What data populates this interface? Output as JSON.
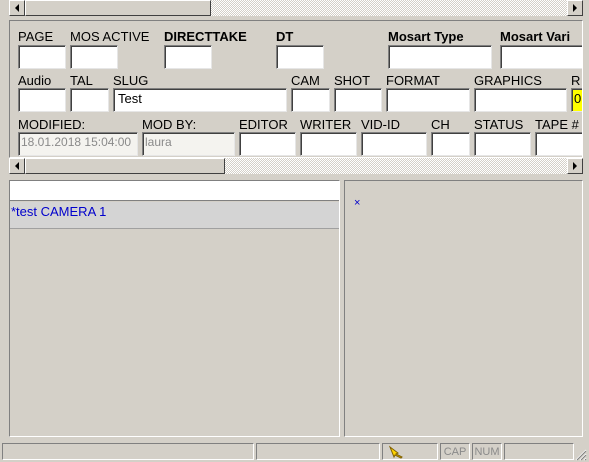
{
  "header_fields": {
    "row1": {
      "page": "PAGE",
      "mos_active": "MOS ACTIVE",
      "directtake": "DIRECTTAKE",
      "dt": "DT",
      "mosart_type": "Mosart Type",
      "mosart_variant": "Mosart Vari"
    },
    "row2": {
      "audio": "Audio",
      "tal": "TAL",
      "slug": "SLUG",
      "slug_value": "Test",
      "cam": "CAM",
      "shot": "SHOT",
      "format": "FORMAT",
      "graphics": "GRAPHICS",
      "r": "R",
      "r_value": "0"
    },
    "row3": {
      "modified": "MODIFIED:",
      "modified_value": "18.01.2018 15:04:00",
      "mod_by": "MOD BY:",
      "mod_by_value": "laura",
      "editor": "EDITOR",
      "writer": "WRITER",
      "vid_id": "VID-ID",
      "ch": "CH",
      "status": "STATUS",
      "tape": "TAPE #"
    }
  },
  "list_panel": {
    "header": "",
    "items": [
      {
        "label": "*test CAMERA 1",
        "selected": true
      }
    ]
  },
  "right_panel": {
    "marker": "×"
  },
  "status_bar": {
    "cap": "CAP",
    "num": "NUM"
  },
  "colors": {
    "window_bg": "#d4d0c8",
    "list_text": "#0000cc",
    "highlight_field": "#ffff00"
  }
}
